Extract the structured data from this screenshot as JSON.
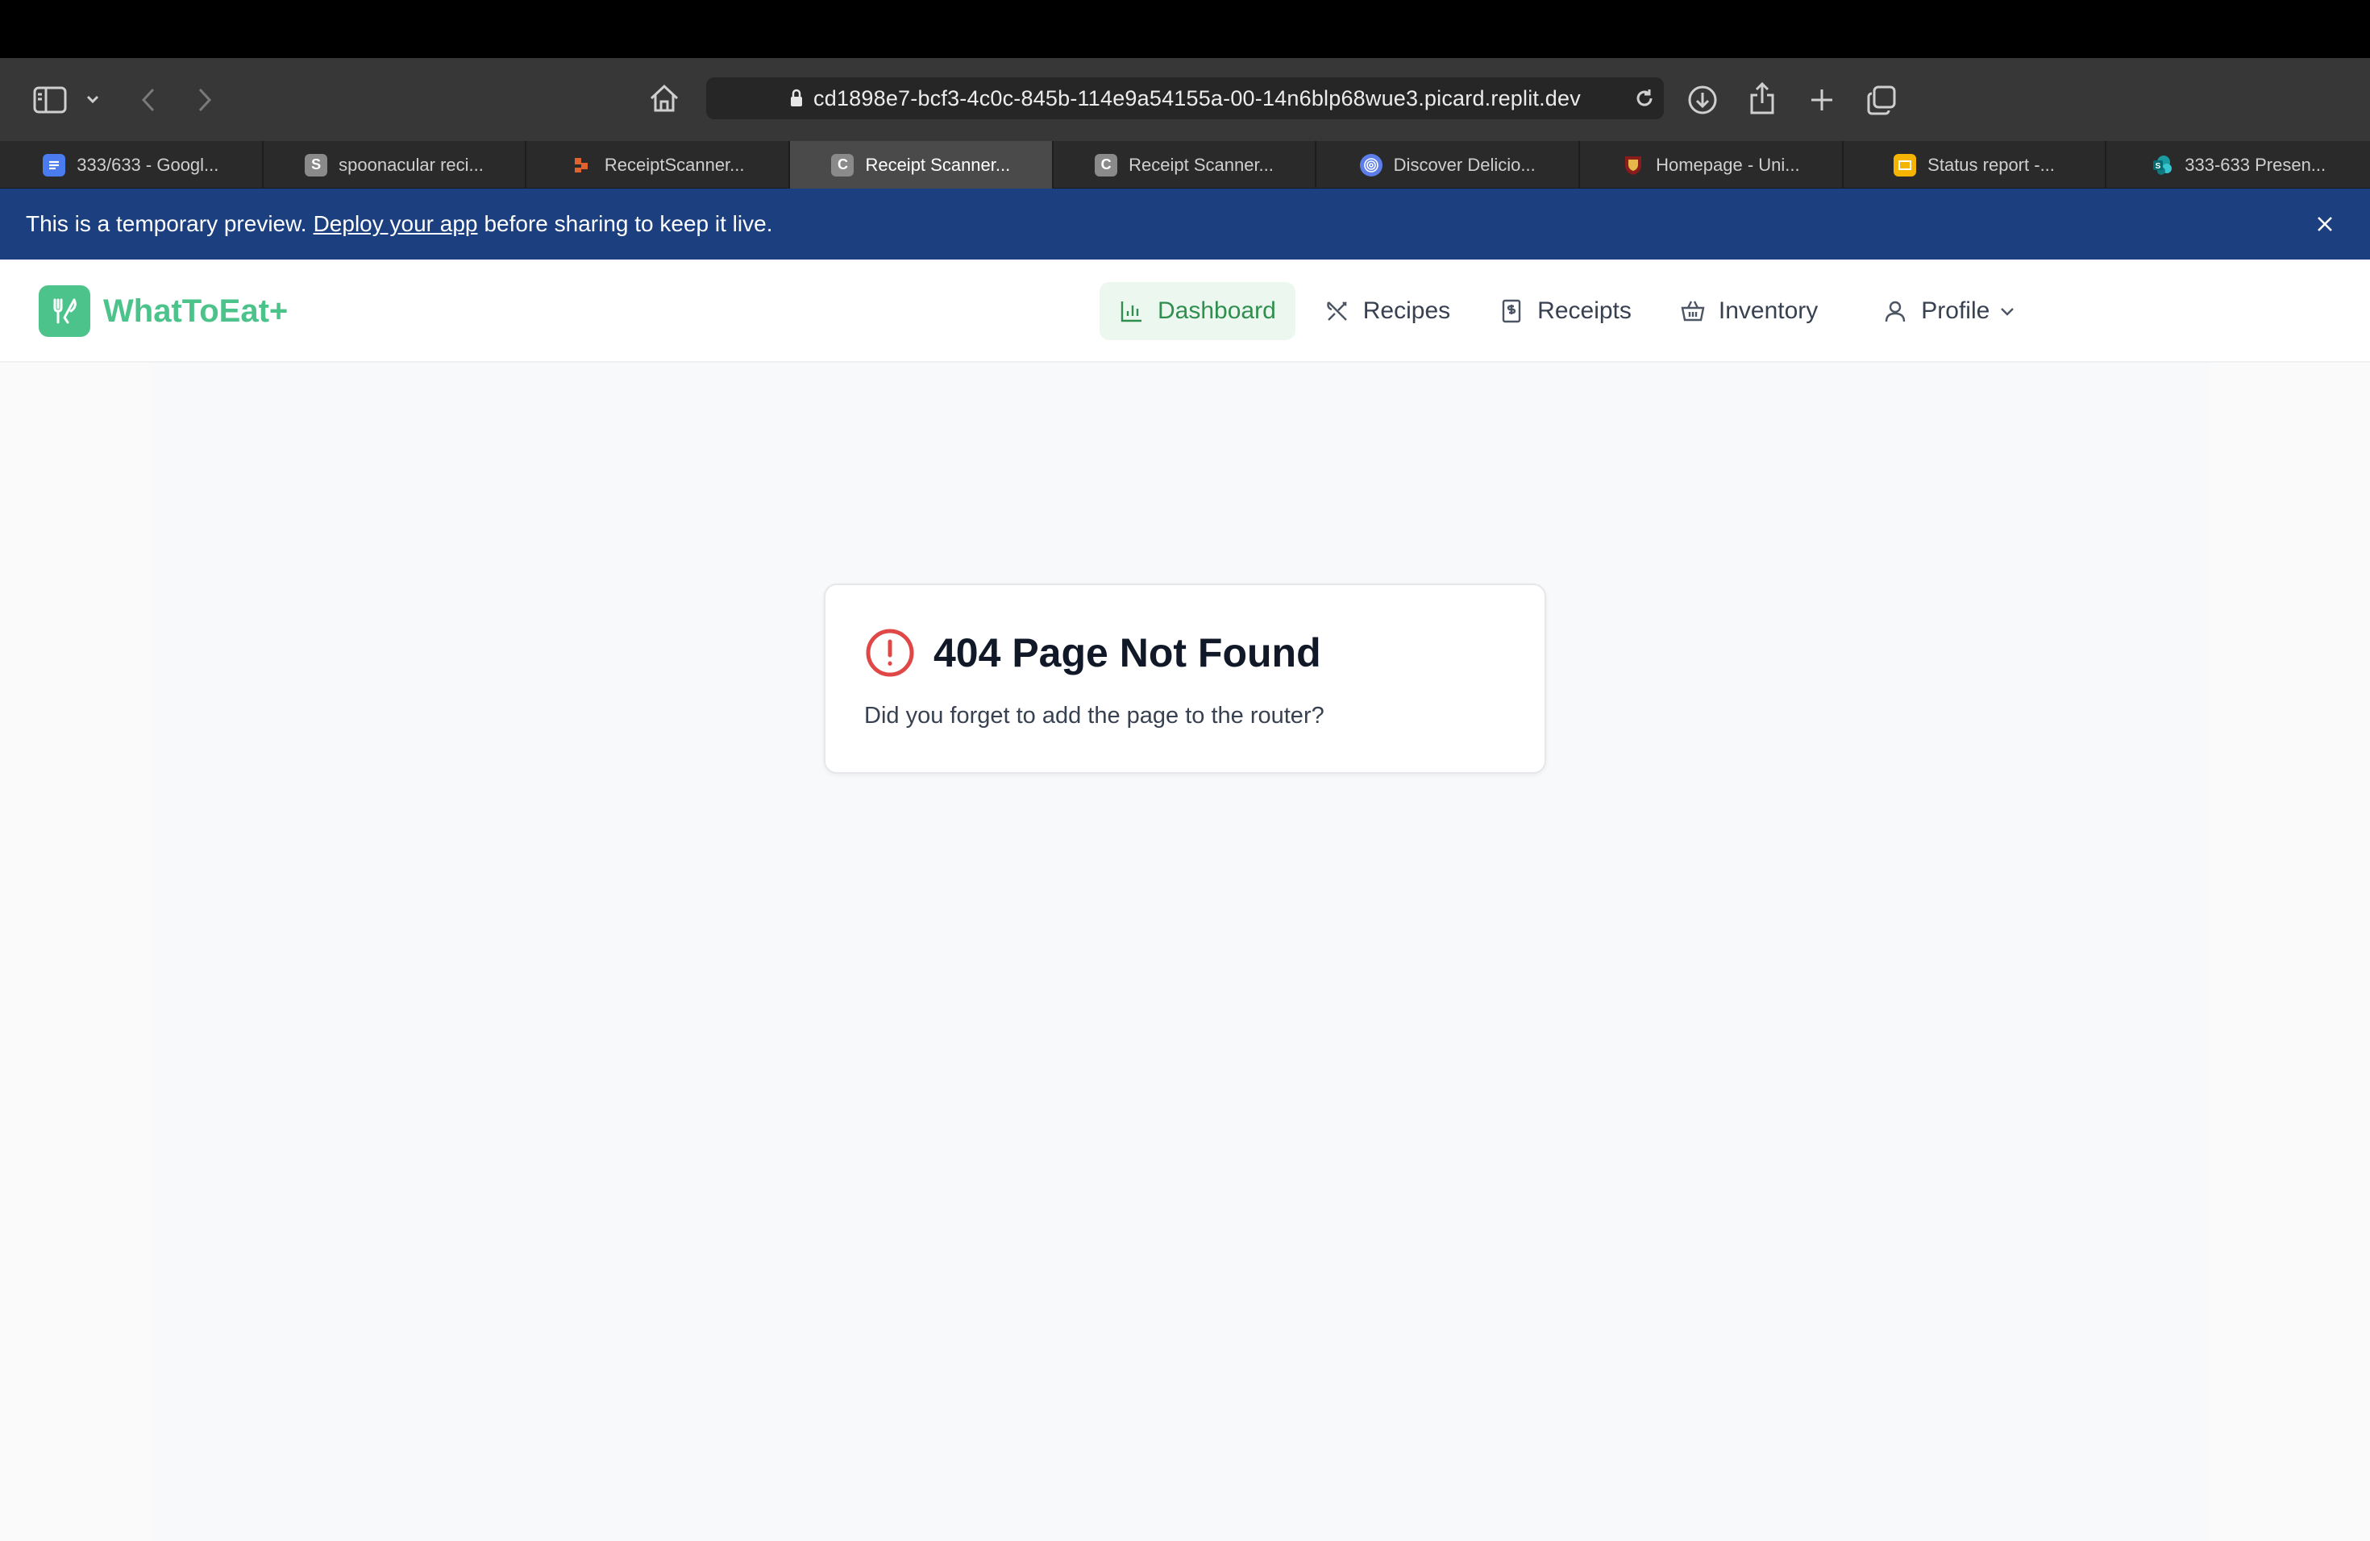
{
  "browser": {
    "url": "cd1898e7-bcf3-4c0c-845b-114e9a54155a-00-14n6blp68wue3.picard.replit.dev",
    "tabs": [
      {
        "label": "333/633 - Googl...",
        "favicon": "google-docs-icon",
        "color": "#4a7cf0",
        "active": false
      },
      {
        "label": "spoonacular reci...",
        "favicon": "s-letter-icon",
        "color": "#8a8a8a",
        "glyph": "S",
        "active": false
      },
      {
        "label": "ReceiptScanner...",
        "favicon": "figma-dots-icon",
        "color": "#e0622e",
        "active": false
      },
      {
        "label": "Receipt Scanner...",
        "favicon": "c-letter-icon",
        "color": "#8a8a8a",
        "glyph": "C",
        "active": true
      },
      {
        "label": "Receipt Scanner...",
        "favicon": "c-letter-icon",
        "color": "#8a8a8a",
        "glyph": "C",
        "active": false
      },
      {
        "label": "Discover Delicio...",
        "favicon": "fingerprint-icon",
        "color": "#5d7ee8",
        "active": false
      },
      {
        "label": "Homepage - Uni...",
        "favicon": "crest-icon",
        "color": "#8a1c1c",
        "active": false
      },
      {
        "label": "Status report -...",
        "favicon": "slides-icon",
        "color": "#f4b400",
        "active": false
      },
      {
        "label": "333-633 Presen...",
        "favicon": "sharepoint-icon",
        "color": "#1a9ba1",
        "active": false
      }
    ]
  },
  "banner": {
    "before": "This is a temporary preview.",
    "link": "Deploy your app",
    "after": "before sharing to keep it live."
  },
  "app": {
    "name": "WhatToEat+",
    "brand_color": "#4cc38a",
    "nav": {
      "dashboard": "Dashboard",
      "recipes": "Recipes",
      "receipts": "Receipts",
      "inventory": "Inventory",
      "profile": "Profile"
    }
  },
  "error": {
    "title": "404 Page Not Found",
    "message": "Did you forget to add the page to the router?",
    "icon": "alert-circle-icon",
    "icon_color": "#e04848"
  }
}
